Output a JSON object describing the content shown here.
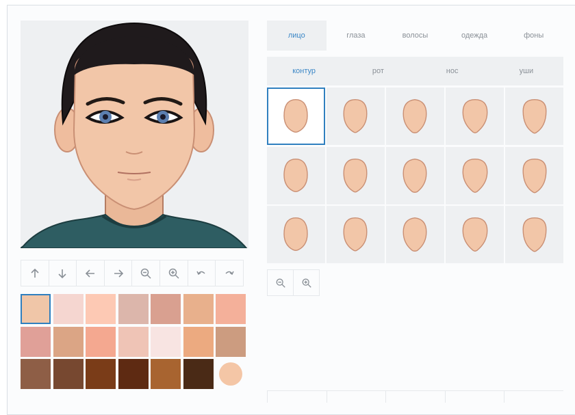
{
  "category_tabs": [
    {
      "label": "лицо",
      "active": true
    },
    {
      "label": "глаза",
      "active": false
    },
    {
      "label": "волосы",
      "active": false
    },
    {
      "label": "одежда",
      "active": false
    },
    {
      "label": "фоны",
      "active": false
    }
  ],
  "sub_tabs": [
    {
      "label": "контур",
      "active": true
    },
    {
      "label": "рот",
      "active": false
    },
    {
      "label": "нос",
      "active": false
    },
    {
      "label": "уши",
      "active": false
    }
  ],
  "toolbar_icons": [
    "arrow-up-icon",
    "arrow-down-icon",
    "arrow-left-icon",
    "arrow-right-icon",
    "zoom-out-icon",
    "zoom-in-icon",
    "undo-icon",
    "redo-icon"
  ],
  "skin_swatches": [
    "#f0c6a8",
    "#f5d6d0",
    "#fdc9b4",
    "#dcb6ab",
    "#d9a090",
    "#e8b08c",
    "#f4b09a",
    "#e0a098",
    "#dba585",
    "#f4a890",
    "#efc4b6",
    "#f8e4e2",
    "#ecaa80",
    "#cc9c80",
    "#8e5e46",
    "#774830",
    "#7a3c18",
    "#5e2a12",
    "#a86430",
    "#4a2a16",
    "#f4c6a6"
  ],
  "selected_swatch_index": 0,
  "selected_shape_index": 0,
  "colors": {
    "accent": "#3a86c6",
    "face_fill": "#f2c6a8",
    "face_outline": "#c98f74",
    "shirt": "#2e5d62",
    "hair": "#1f1a1c"
  }
}
